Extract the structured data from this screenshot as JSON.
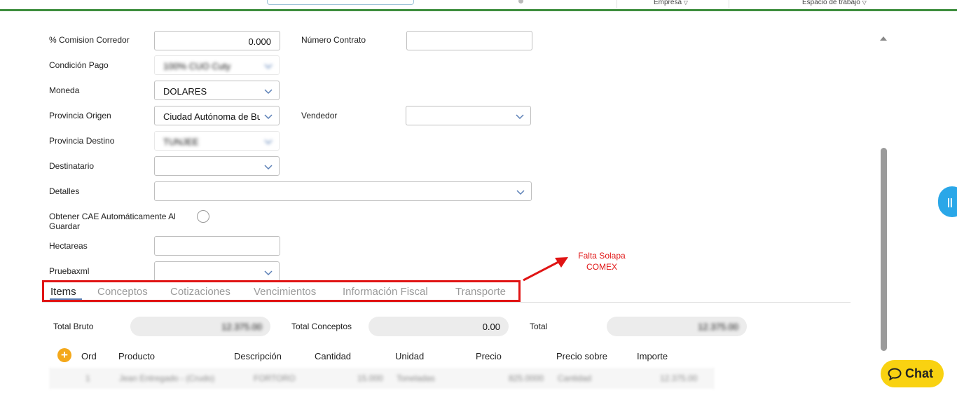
{
  "header": {
    "empresa_label": "Empresa",
    "espacio_label": "Espacio de trabajo"
  },
  "form": {
    "comision_label": "% Comision Corredor",
    "comision_value": "0.000",
    "numero_contrato_label": "Número Contrato",
    "numero_contrato_value": "",
    "condicion_pago_label": "Condición Pago",
    "condicion_pago_value": "100% CUO Cuty",
    "moneda_label": "Moneda",
    "moneda_value": "DOLARES",
    "provincia_origen_label": "Provincia Origen",
    "provincia_origen_value": "Ciudad Autónoma de Buenos Aires",
    "vendedor_label": "Vendedor",
    "vendedor_value": "",
    "provincia_destino_label": "Provincia Destino",
    "provincia_destino_value": "TUNJEE",
    "destinatario_label": "Destinatario",
    "detalles_label": "Detalles",
    "obtener_cae_label": "Obtener CAE Automáticamente Al Guardar",
    "hectareas_label": "Hectareas",
    "hectareas_value": "",
    "pruebaxml_label": "Pruebaxml"
  },
  "tabs": [
    {
      "label": "Items"
    },
    {
      "label": "Conceptos"
    },
    {
      "label": "Cotizaciones"
    },
    {
      "label": "Vencimientos"
    },
    {
      "label": "Información Fiscal"
    },
    {
      "label": "Transporte"
    }
  ],
  "annotation": {
    "line1": "Falta Solapa",
    "line2": "COMEX",
    "color": "#e01414"
  },
  "totals": {
    "total_bruto_label": "Total Bruto",
    "total_bruto_value": "12.375.00",
    "total_conceptos_label": "Total Conceptos",
    "total_conceptos_value": "0.00",
    "total_label": "Total",
    "total_value": "12.375.00"
  },
  "items_table": {
    "add_icon": "plus-circle-icon",
    "headers": [
      "Ord",
      "Producto",
      "Descripción",
      "Cantidad",
      "Unidad",
      "Precio",
      "Precio sobre",
      "Importe"
    ],
    "rows": [
      [
        "1",
        "Jean Entregado - (Crudo)",
        "FORTORO",
        "15.000",
        "Toneladas",
        "825.0000",
        "Cantidad",
        "12.375.00"
      ]
    ]
  },
  "chat": {
    "label": "Chat",
    "color": "#f9d211"
  },
  "colors": {
    "header_rule": "#3e8e3e",
    "tab_active_underline": "#5a7fb6",
    "side_handle": "#2aa7e8"
  }
}
